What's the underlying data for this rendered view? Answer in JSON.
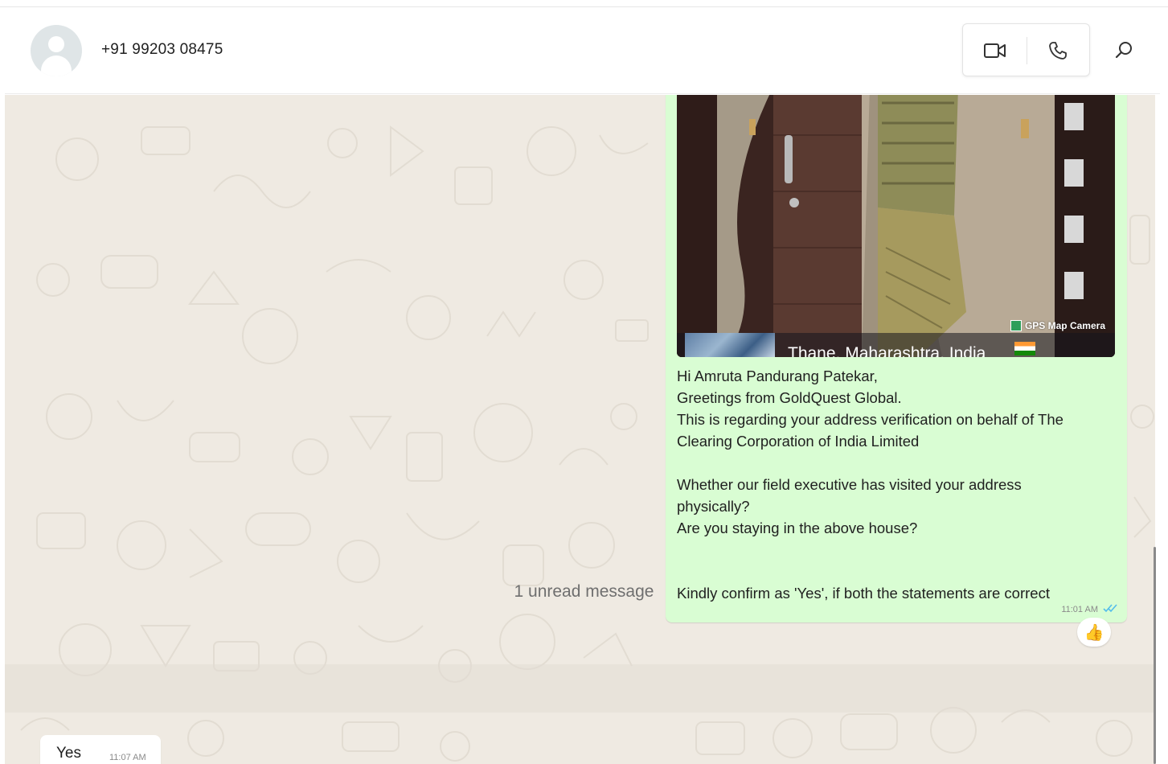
{
  "header": {
    "contact_name": "+91 99203 08475",
    "icons": [
      "avatar-placeholder",
      "video-call-icon",
      "voice-call-icon",
      "search-icon"
    ]
  },
  "messages": {
    "outgoing": {
      "photo_watermark": "GPS Map Camera",
      "photo_location": "Thane, Maharashtra, India",
      "lines": [
        "Hi Amruta Pandurang Patekar,",
        "Greetings from GoldQuest Global.",
        "This is regarding your address verification on behalf of The",
        "Clearing Corporation of India Limited",
        "",
        "Whether our field executive has visited your address",
        "physically?",
        "Are you staying in the above house?",
        "",
        "",
        "Kindly confirm as 'Yes', if both the statements are correct"
      ],
      "time": "11:01 AM",
      "status": "read",
      "reaction": "👍"
    },
    "unread_divider": "1 unread message",
    "incoming": {
      "text": "Yes",
      "time": "11:07 AM"
    }
  },
  "colors": {
    "chat_background": "#efeae2",
    "outgoing_bubble": "#d9fdd3",
    "incoming_bubble": "#ffffff",
    "read_ticks": "#53bdeb"
  }
}
